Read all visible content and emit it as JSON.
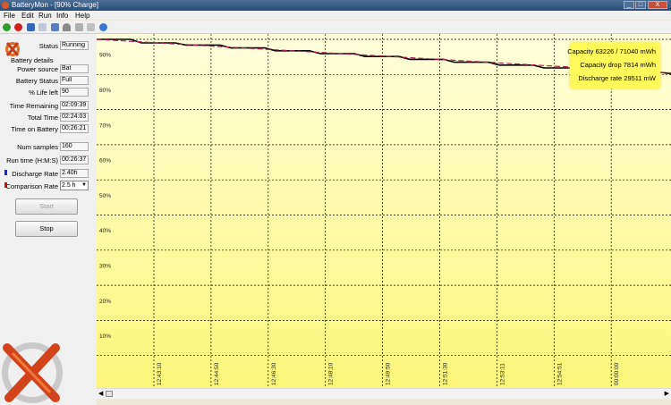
{
  "window": {
    "title": "BatteryMon - [90% Charge]",
    "buttons": [
      "_",
      "□",
      "X"
    ]
  },
  "menu": [
    "File",
    "Edit",
    "Run",
    "Info",
    "Help"
  ],
  "toolbar": [
    "start-icon",
    "stop-icon",
    "save-icon",
    "report-icon",
    "export-icon",
    "gauge-icon",
    "settings-icon",
    "options-icon",
    "help-icon"
  ],
  "status": {
    "label": "Status",
    "value": "Running"
  },
  "details": {
    "heading": "Battery details",
    "rows": [
      {
        "label": "Power source",
        "value": "Bat"
      },
      {
        "label": "Battery Status",
        "value": "Full"
      },
      {
        "label": "% Life left",
        "value": "90"
      },
      {
        "label": "Time Remaining",
        "value": "02:09:39"
      },
      {
        "label": "Total Time",
        "value": "02:24:03"
      },
      {
        "label": "Time on Battery",
        "value": "00:26:21"
      }
    ]
  },
  "samples": {
    "label": "Num samples",
    "value": "160"
  },
  "runtime": {
    "label": "Run time (H:M:S)",
    "value": "00:26:37"
  },
  "discharge": {
    "label": "Discharge Rate",
    "value": "2.40h",
    "color": "#1a2ad0"
  },
  "comparison": {
    "label": "Comparison Rate",
    "value": "2.5 h",
    "color": "#cc1010"
  },
  "buttons": {
    "start": "Start",
    "stop": "Stop"
  },
  "legend": {
    "capacity": "Capacity 63226 / 71040 mWh",
    "drop": "Capacity drop 7814 mWh",
    "rate": "Discharge rate 29511 mW"
  },
  "chart_data": {
    "type": "line",
    "ylabels": [
      "90%",
      "80%",
      "70%",
      "60%",
      "50%",
      "40%",
      "30%",
      "20%",
      "10%"
    ],
    "xlabels": [
      "12:43:10",
      "12:44:50",
      "12:46:30",
      "12:48:10",
      "12:49:50",
      "12:51:30",
      "12:53:11",
      "12:54:51",
      "00:00:00"
    ],
    "series": [
      {
        "x": [
          0,
          50,
          100,
          150,
          200,
          250,
          300,
          350,
          400,
          450,
          500,
          550,
          600,
          642
        ],
        "y": [
          91,
          90.5,
          90.2,
          89.8,
          89.4,
          89,
          88.6,
          88.2,
          87.8,
          87.4,
          87,
          86.6,
          86.4,
          86.2
        ],
        "color": "#000000"
      },
      {
        "x": [
          0,
          642
        ],
        "y": [
          91,
          86.3
        ],
        "color": "#b02050"
      }
    ],
    "colors": {
      "background": "#ffffd0",
      "grid": "#000000"
    }
  }
}
